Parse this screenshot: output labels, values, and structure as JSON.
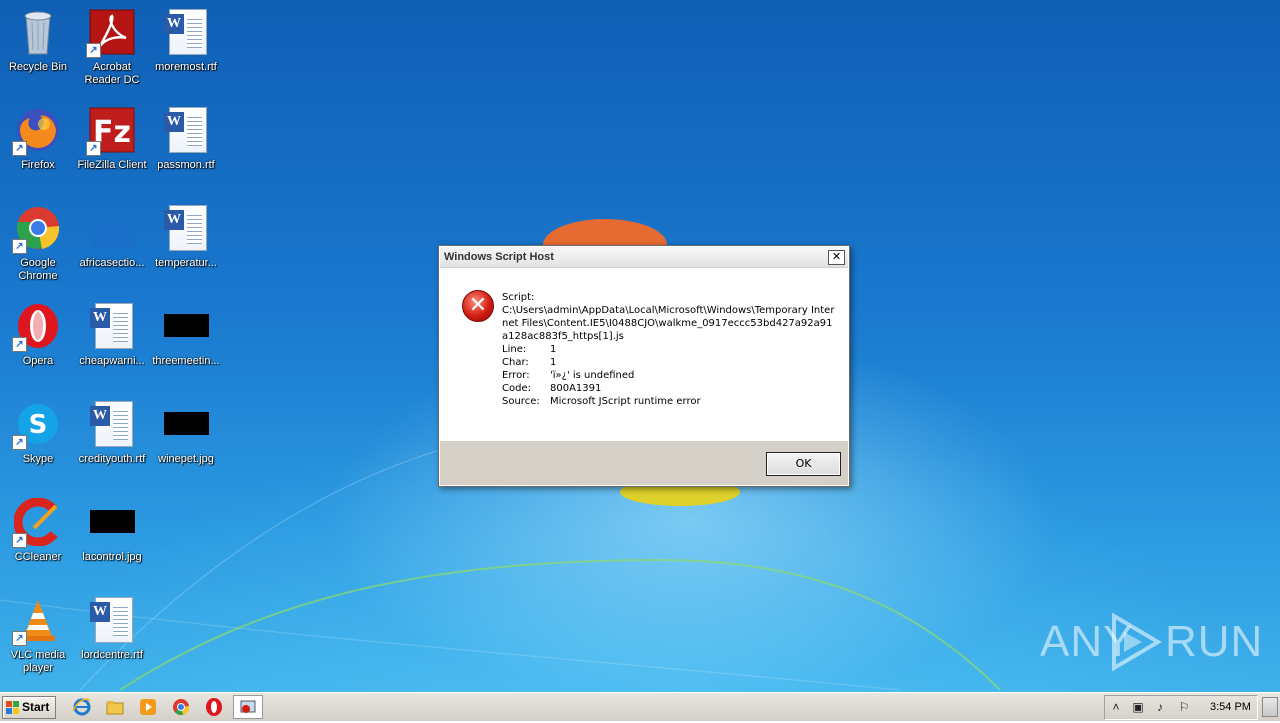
{
  "desktop_icons": {
    "recycle_bin": "Recycle Bin",
    "acrobat": "Acrobat Reader DC",
    "moremost": "moremost.rtf",
    "firefox": "Firefox",
    "filezilla": "FileZilla Client",
    "passmon": "passmon.rtf",
    "chrome": "Google Chrome",
    "africasection": "africasectio...",
    "temperature": "temperatur...",
    "opera": "Opera",
    "cheapwarning": "cheapwarni...",
    "threemeeting": "threemeetin...",
    "skype": "Skype",
    "credityouth": "credityouth.rtf",
    "winepet": "winepet.jpg",
    "ccleaner": "CCleaner",
    "lacontrol": "lacontrol.jpg",
    "vlc": "VLC media player",
    "lordcentre": "lordcentre.rtf"
  },
  "dialog": {
    "title": "Windows Script Host",
    "close": "✕",
    "script_label": "Script:",
    "script_path": "C:\\Users\\admin\\AppData\\Local\\Microsoft\\Windows\\Temporary Internet Files\\Content.IE5\\I0488CJO\\walkme_0917eccc53bd427a92a91a128ac883f5_https[1].js",
    "fields": [
      {
        "key": "Line:",
        "value": "1"
      },
      {
        "key": "Char:",
        "value": "1"
      },
      {
        "key": "Error:",
        "value": "'ï»¿' is undefined"
      },
      {
        "key": "Code:",
        "value": "800A1391"
      },
      {
        "key": "Source:",
        "value": "Microsoft JScript runtime error"
      }
    ],
    "ok_label": "OK"
  },
  "watermark": {
    "left": "ANY",
    "right": "RUN"
  },
  "taskbar": {
    "start_label": "Start",
    "clock": "3:54 PM"
  },
  "colors": {
    "desktop_top": "#0f5fb5",
    "desktop_bottom": "#3fb1ea",
    "dialog_face": "#d4d0c8",
    "error_red": "#d21d12"
  }
}
